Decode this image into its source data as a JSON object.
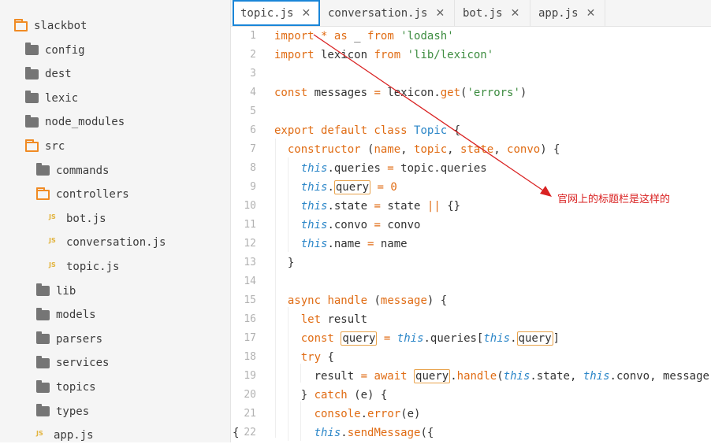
{
  "sidebar": {
    "items": [
      {
        "label": "slackbot",
        "type": "folder-open",
        "indent": 0
      },
      {
        "label": "config",
        "type": "folder",
        "indent": 1
      },
      {
        "label": "dest",
        "type": "folder",
        "indent": 1
      },
      {
        "label": "lexic",
        "type": "folder",
        "indent": 1
      },
      {
        "label": "node_modules",
        "type": "folder",
        "indent": 1
      },
      {
        "label": "src",
        "type": "folder-open",
        "indent": 1
      },
      {
        "label": "commands",
        "type": "folder",
        "indent": 2
      },
      {
        "label": "controllers",
        "type": "folder-open",
        "indent": 2
      },
      {
        "label": "bot.js",
        "type": "file",
        "indent": 3
      },
      {
        "label": "conversation.js",
        "type": "file",
        "indent": 3
      },
      {
        "label": "topic.js",
        "type": "file",
        "indent": 3
      },
      {
        "label": "lib",
        "type": "folder",
        "indent": 2
      },
      {
        "label": "models",
        "type": "folder",
        "indent": 2
      },
      {
        "label": "parsers",
        "type": "folder",
        "indent": 2
      },
      {
        "label": "services",
        "type": "folder",
        "indent": 2
      },
      {
        "label": "topics",
        "type": "folder",
        "indent": 2
      },
      {
        "label": "types",
        "type": "folder",
        "indent": 2
      },
      {
        "label": "app.js",
        "type": "file",
        "indent": 2
      }
    ],
    "js_badge": "JS"
  },
  "tabs": [
    {
      "label": "topic.js",
      "active": true
    },
    {
      "label": "conversation.js",
      "active": false
    },
    {
      "label": "bot.js",
      "active": false
    },
    {
      "label": "app.js",
      "active": false
    }
  ],
  "tab_close": "✕",
  "annotation": "官网上的标题栏是这样的",
  "fold_marker": "{",
  "colors": {
    "accent": "#1a86d8",
    "annotation": "#d92222",
    "folder_open": "#f08b24"
  }
}
